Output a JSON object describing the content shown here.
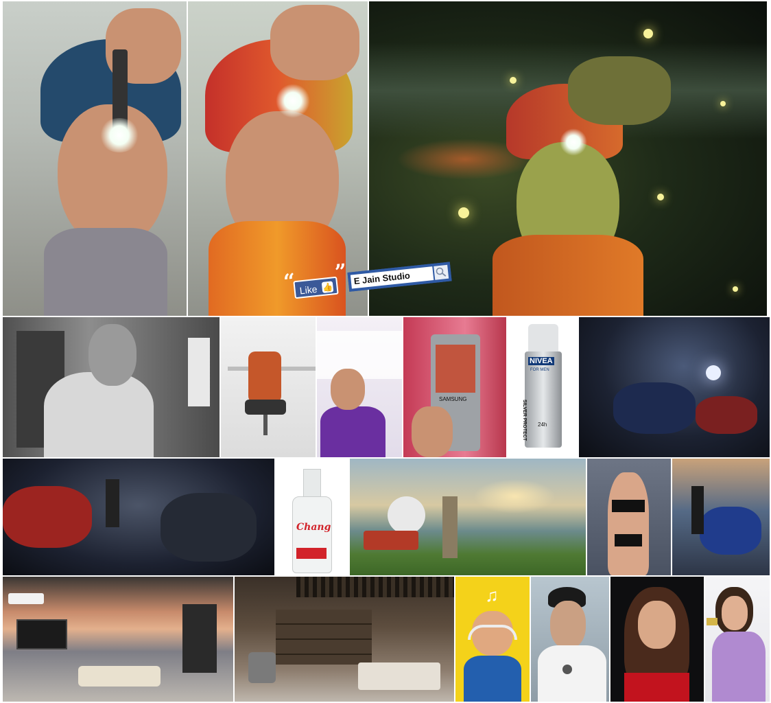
{
  "like_overlay": {
    "open_quote": "“",
    "close_quote": "”",
    "like_label": "Like",
    "search_value": "E Jain Studio"
  },
  "product_text": {
    "phone_brand": "SAMSUNG",
    "deodorant_brand": "NIVEA",
    "deodorant_line": "FOR MEN",
    "deodorant_name": "SILVER PROTECT",
    "deodorant_hours": "24h",
    "bottle_brand": "Chang"
  },
  "colors": {
    "facebook_blue": "#3b5998",
    "search_border": "#2f5aa5",
    "yellow_backdrop": "#f4d21a"
  }
}
